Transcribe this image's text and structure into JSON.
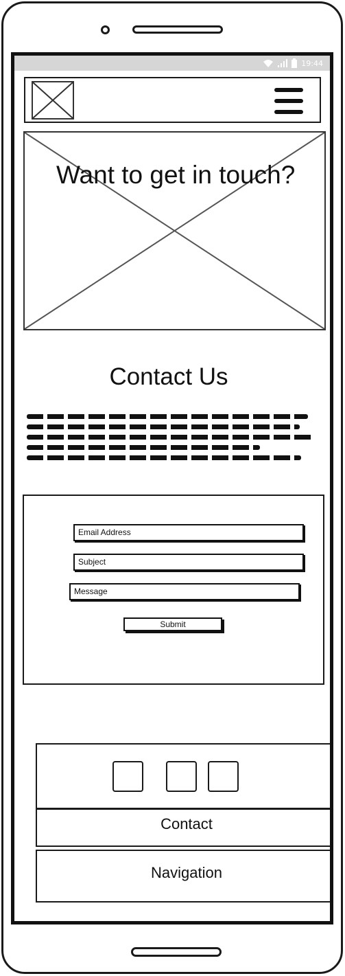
{
  "status_bar": {
    "time": "19:44",
    "icons": [
      "wifi-icon",
      "signal-icon",
      "battery-icon"
    ]
  },
  "header": {
    "logo_icon": "image-placeholder-icon",
    "menu_icon": "hamburger-menu-icon"
  },
  "hero": {
    "title": "Want to get in touch?",
    "image_icon": "image-placeholder-icon"
  },
  "contact_section": {
    "title": "Contact Us"
  },
  "form": {
    "email_placeholder": "Email Address",
    "subject_placeholder": "Subject",
    "message_placeholder": "Message",
    "submit_label": "Submit"
  },
  "footer": {
    "social_icons": [
      "social-icon-1",
      "social-icon-2",
      "social-icon-3"
    ],
    "contact_label": "Contact",
    "navigation_label": "Navigation"
  },
  "colors": {
    "stroke": "#1a1a1a",
    "status_bar_bg": "#d6d6d6",
    "background": "#ffffff"
  }
}
